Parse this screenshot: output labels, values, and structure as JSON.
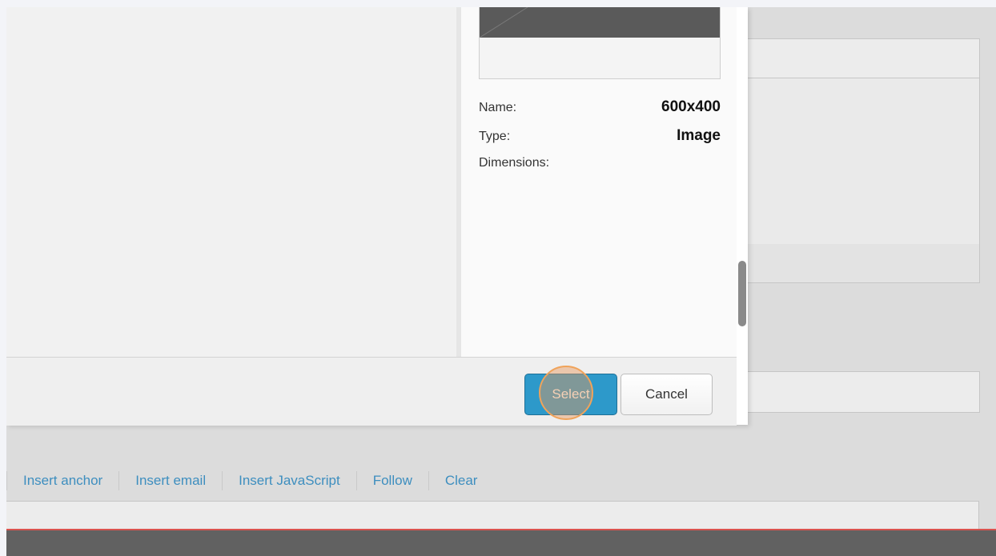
{
  "details": {
    "name_label": "Name:",
    "name_value": "600x400",
    "type_label": "Type:",
    "type_value": "Image",
    "dimensions_label": "Dimensions:"
  },
  "footer": {
    "select_label": "Select",
    "cancel_label": "Cancel"
  },
  "link_toolbar": {
    "items": [
      "Insert anchor",
      "Insert email",
      "Insert JavaScript",
      "Follow",
      "Clear"
    ]
  },
  "colors": {
    "accent": "#2d99ca",
    "link": "#3d8ebf",
    "bottom_bar": "#616161",
    "bottom_bar_border": "#d9534f",
    "click_indicator": "#f0a35a"
  }
}
